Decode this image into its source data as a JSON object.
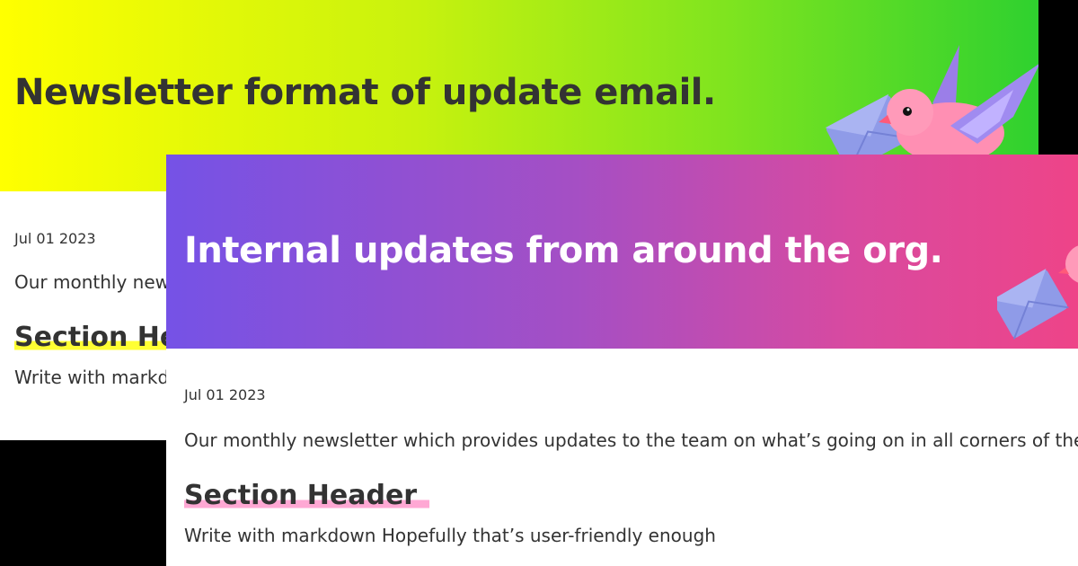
{
  "back_card": {
    "title": "Newsletter format of update email.",
    "date": "Jul 01 2023",
    "intro": "Our monthly newsletter which provides updates to the team on what’s going on in all corners of the org.",
    "section_header": "Section Header",
    "body": "Write with markdown Hopefully that’s user-friendly enough",
    "highlight_color": "#ffff33",
    "banner_colors": [
      "#ffff00",
      "#2fd12f"
    ]
  },
  "front_card": {
    "title": "Internal updates from around the org.",
    "date": "Jul 01 2023",
    "intro": "Our monthly newsletter which provides updates to the team on what’s going on in all corners of the org.",
    "section_header": "Section Header",
    "body": "Write with markdown Hopefully that’s user-friendly enough",
    "highlight_color": "#ffa8d4",
    "banner_colors": [
      "#7552e6",
      "#ee4488"
    ]
  },
  "illustration": {
    "icon": "bird-with-envelope-icon"
  }
}
